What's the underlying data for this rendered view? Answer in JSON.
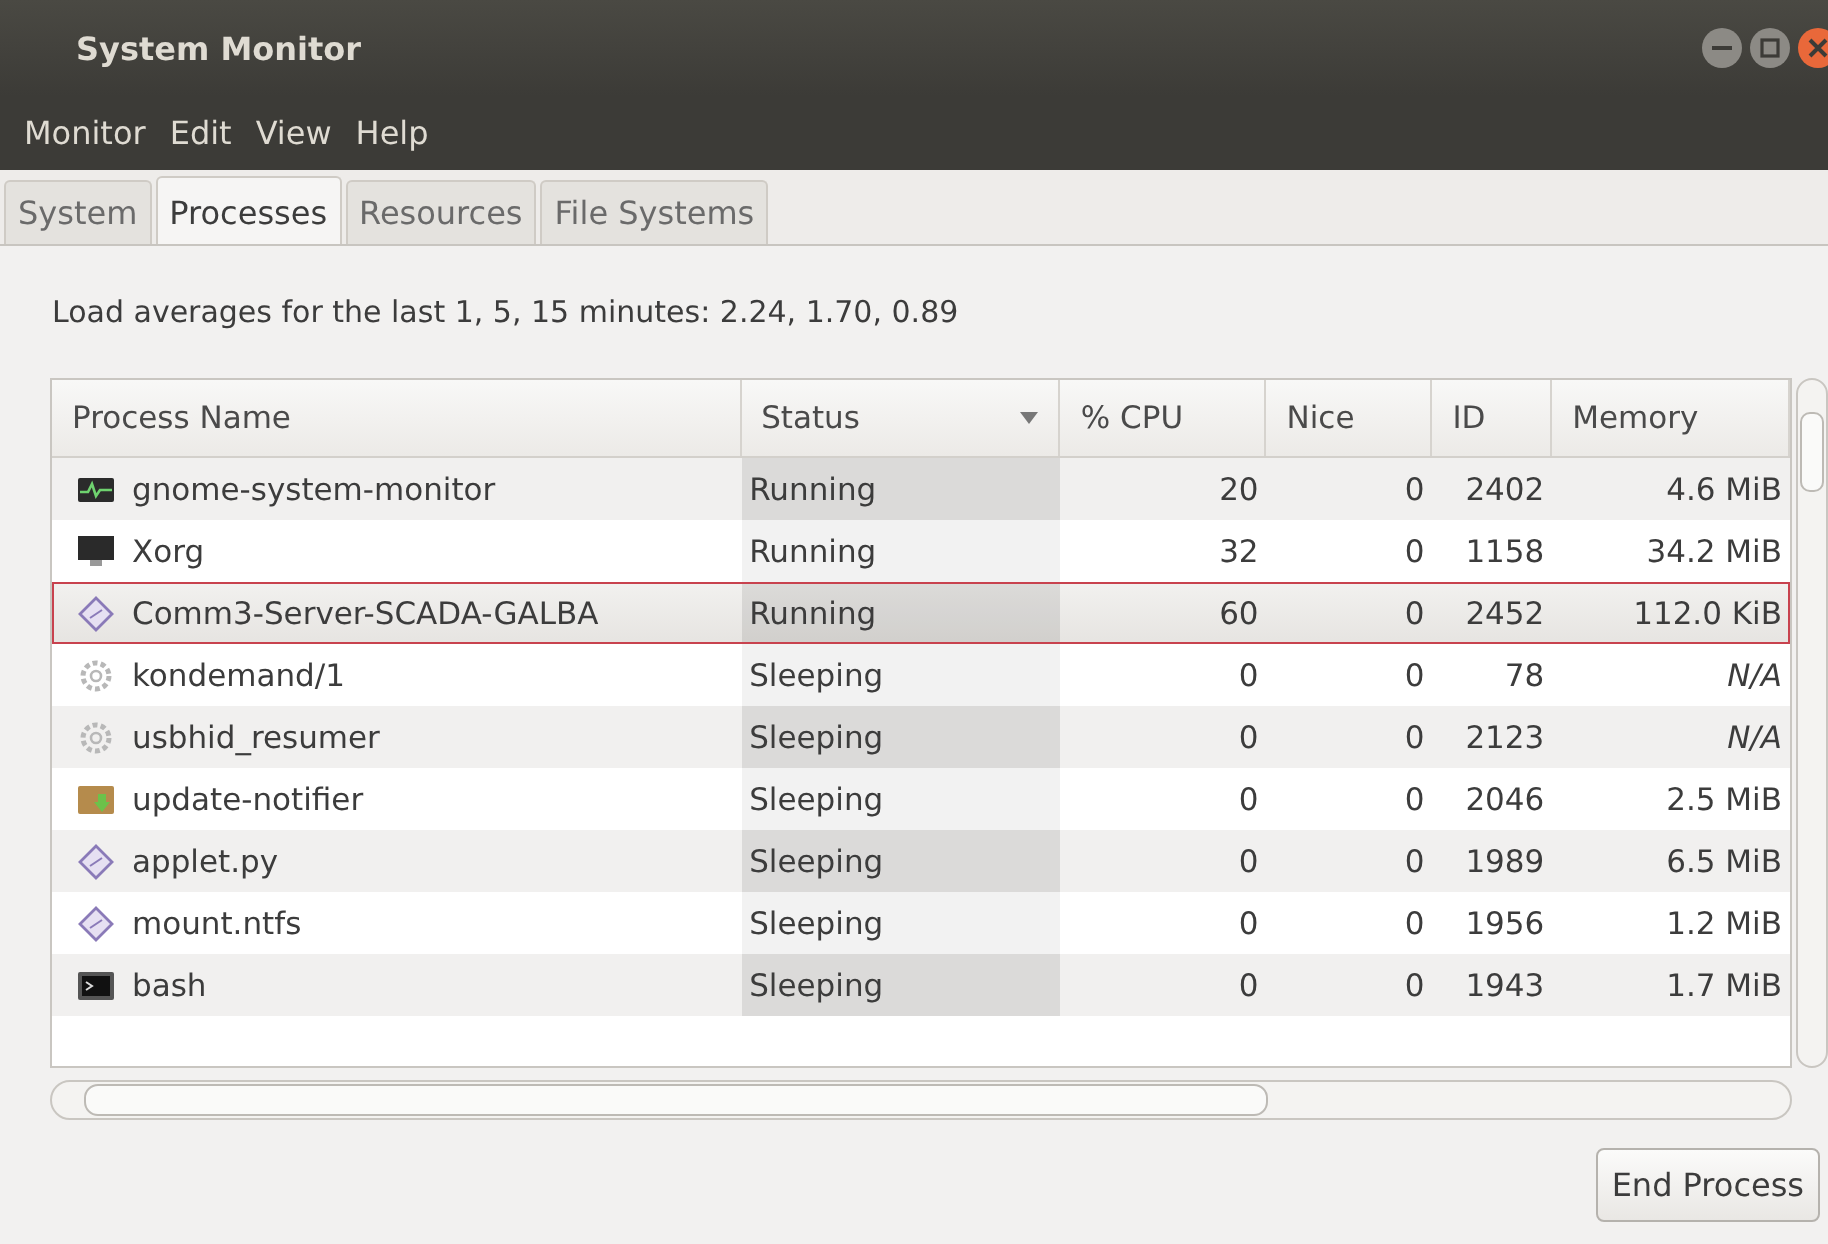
{
  "window": {
    "title": "System Monitor"
  },
  "menu": [
    "Monitor",
    "Edit",
    "View",
    "Help"
  ],
  "tabs": [
    {
      "label": "System",
      "selected": false
    },
    {
      "label": "Processes",
      "selected": true
    },
    {
      "label": "Resources",
      "selected": false
    },
    {
      "label": "File Systems",
      "selected": false
    }
  ],
  "load_averages": "Load averages for the last 1, 5, 15 minutes: 2.24, 1.70, 0.89",
  "table": {
    "columns": [
      {
        "label": "Process Name",
        "sorted": false
      },
      {
        "label": "Status",
        "sorted": true
      },
      {
        "label": "% CPU",
        "sorted": false
      },
      {
        "label": "Nice",
        "sorted": false
      },
      {
        "label": "ID",
        "sorted": false
      },
      {
        "label": "Memory",
        "sorted": false
      }
    ],
    "rows": [
      {
        "kind": "monitor",
        "name": "gnome-system-monitor",
        "status": "Running",
        "cpu": "20",
        "nice": "0",
        "id": "2402",
        "memory": "4.6 MiB",
        "selected": false
      },
      {
        "kind": "display",
        "name": "Xorg",
        "status": "Running",
        "cpu": "32",
        "nice": "0",
        "id": "1158",
        "memory": "34.2 MiB",
        "selected": false
      },
      {
        "kind": "diamond",
        "name": "Comm3-Server-SCADA-GALBA",
        "status": "Running",
        "cpu": "60",
        "nice": "0",
        "id": "2452",
        "memory": "112.0 KiB",
        "selected": true
      },
      {
        "kind": "gear",
        "name": "kondemand/1",
        "status": "Sleeping",
        "cpu": "0",
        "nice": "0",
        "id": "78",
        "memory": "N/A",
        "selected": false
      },
      {
        "kind": "gear",
        "name": "usbhid_resumer",
        "status": "Sleeping",
        "cpu": "0",
        "nice": "0",
        "id": "2123",
        "memory": "N/A",
        "selected": false
      },
      {
        "kind": "package",
        "name": "update-notifier",
        "status": "Sleeping",
        "cpu": "0",
        "nice": "0",
        "id": "2046",
        "memory": "2.5 MiB",
        "selected": false
      },
      {
        "kind": "diamond",
        "name": "applet.py",
        "status": "Sleeping",
        "cpu": "0",
        "nice": "0",
        "id": "1989",
        "memory": "6.5 MiB",
        "selected": false
      },
      {
        "kind": "diamond",
        "name": "mount.ntfs",
        "status": "Sleeping",
        "cpu": "0",
        "nice": "0",
        "id": "1956",
        "memory": "1.2 MiB",
        "selected": false
      },
      {
        "kind": "terminal",
        "name": "bash",
        "status": "Sleeping",
        "cpu": "0",
        "nice": "0",
        "id": "1943",
        "memory": "1.7 MiB",
        "selected": false
      }
    ]
  },
  "buttons": [
    "End Process"
  ]
}
